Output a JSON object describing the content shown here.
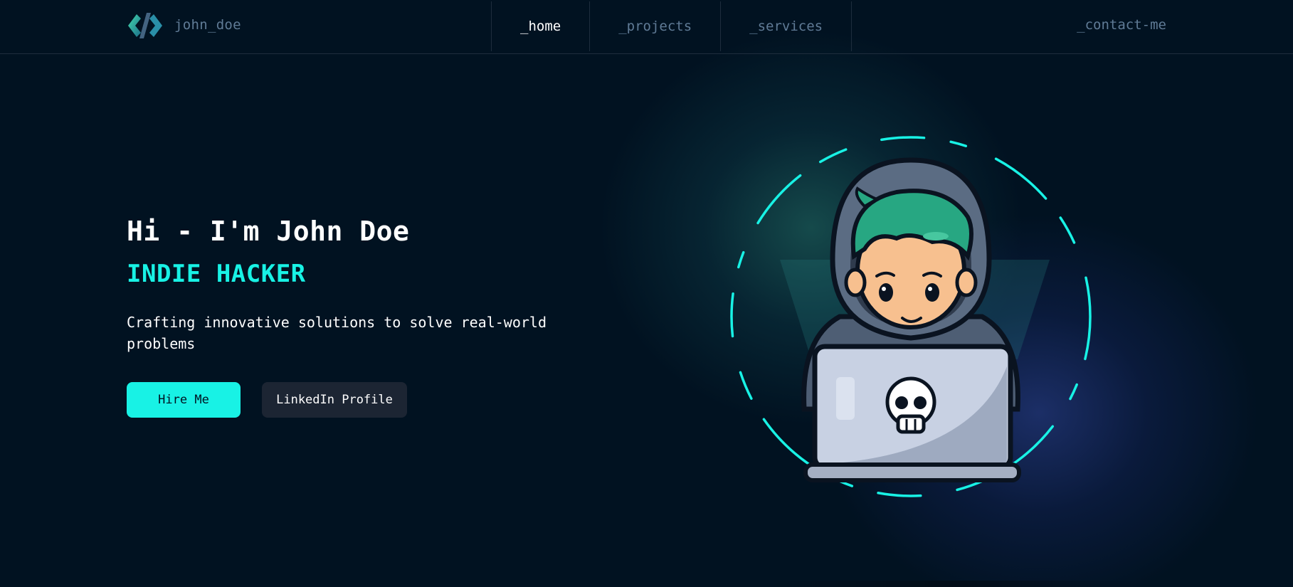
{
  "header": {
    "brand": "john_doe",
    "logo_icon": "code-brackets-icon",
    "nav": [
      {
        "label": "_home",
        "active": true
      },
      {
        "label": "_projects",
        "active": false
      },
      {
        "label": "_services",
        "active": false
      }
    ],
    "contact": "_contact-me"
  },
  "hero": {
    "greeting": "Hi - I'm John Doe",
    "role": "INDIE HACKER",
    "description": "Crafting innovative solutions to solve real-world problems",
    "hire_button": "Hire Me",
    "linkedin_button": "LinkedIn Profile",
    "illustration_icon": "hacker-with-laptop-icon"
  },
  "colors": {
    "background": "#011221",
    "accent": "#18F2E5",
    "muted_text": "#607B96",
    "border": "#1E2D3D",
    "secondary_button": "#1C2533"
  }
}
